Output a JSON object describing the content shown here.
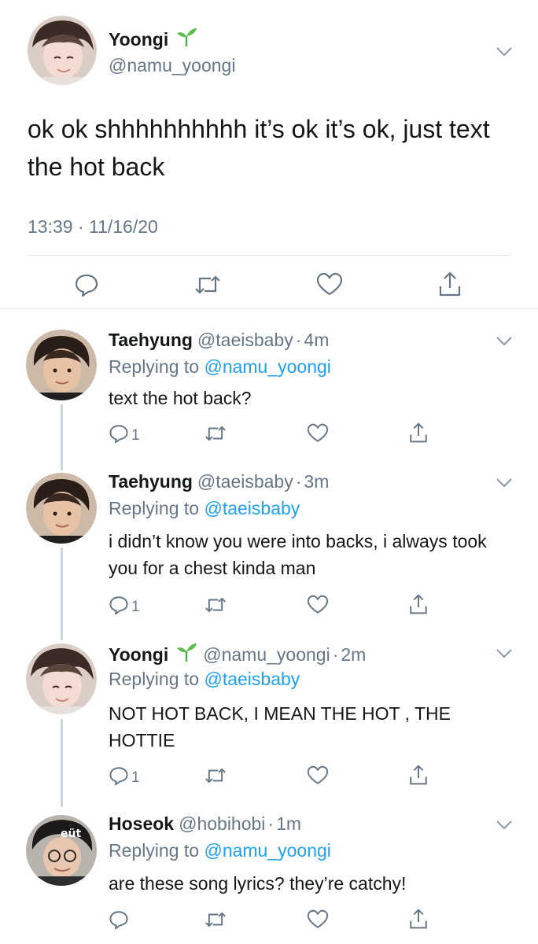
{
  "main_tweet": {
    "display_name": "Yoongi",
    "handle": "@namu_yoongi",
    "text": "ok ok shhhhhhhhhh it’s ok it’s ok, just text the hot back",
    "timestamp": "13:39 · 11/16/20",
    "icons": {
      "name_badge": "sprout-icon",
      "menu": "chevron-down-icon",
      "reply": "comment-icon",
      "retweet": "retweet-icon",
      "like": "heart-icon",
      "share": "share-icon"
    }
  },
  "replies": [
    {
      "display_name": "Taehyung",
      "handle": "@taeisbaby",
      "dot": "·",
      "time": "4m",
      "replying_prefix": "Replying to",
      "replying_to": "@namu_yoongi",
      "text": "text the hot back?",
      "reply_count": "1",
      "has_sprout": false
    },
    {
      "display_name": "Taehyung",
      "handle": "@taeisbaby",
      "dot": "·",
      "time": "3m",
      "replying_prefix": "Replying to",
      "replying_to": "@taeisbaby",
      "text": "i didn’t know you were into backs, i always took you for a chest kinda man",
      "reply_count": "1",
      "has_sprout": false
    },
    {
      "display_name": "Yoongi",
      "handle": "@namu_yoongi",
      "dot": "·",
      "time": "2m",
      "replying_prefix": "Replying to",
      "replying_to": "@taeisbaby",
      "text": "NOT HOT BACK, I MEAN THE HOT , THE HOTTIE",
      "reply_count": "1",
      "has_sprout": true
    },
    {
      "display_name": "Hoseok",
      "handle": "@hobihobi",
      "dot": "·",
      "time": "1m",
      "replying_prefix": "Replying to",
      "replying_to": "@namu_yoongi",
      "text": "are these song lyrics? they’re catchy!",
      "reply_count": "",
      "has_sprout": false
    }
  ],
  "colors": {
    "text": "#14171a",
    "secondary": "#657786",
    "link": "#1da1f2",
    "divider": "#e1e8ed",
    "thread_line": "#ccd6dd",
    "sprout": "#4caf50"
  }
}
